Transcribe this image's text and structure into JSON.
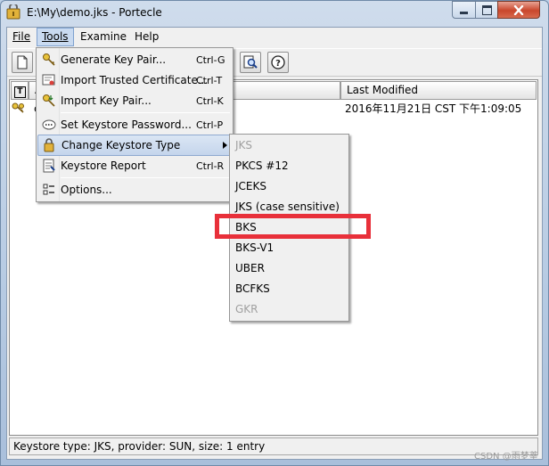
{
  "window": {
    "title": "E:\\My\\demo.jks - Portecle",
    "minimize_icon": "minimize-icon",
    "maximize_icon": "maximize-icon",
    "close_icon": "close-icon"
  },
  "menubar": {
    "items": [
      {
        "label": "File",
        "accel_char": "F"
      },
      {
        "label": "Tools",
        "accel_char": "T"
      },
      {
        "label": "Examine",
        "accel_char": "E"
      },
      {
        "label": "Help",
        "accel_char": "H"
      }
    ]
  },
  "toolbar": {
    "buttons": [
      {
        "icon": "new-keystore-icon"
      },
      {
        "icon": "examine-icon"
      },
      {
        "icon": "help-icon"
      }
    ]
  },
  "table": {
    "columns": [
      "T",
      "A",
      "Last Modified"
    ],
    "rows": [
      {
        "type_icon": "key-pair-icon",
        "alias": "c",
        "last_modified": "2016年11月21日 CST 下午1:09:05"
      }
    ]
  },
  "tools_menu": {
    "items": [
      {
        "label": "Generate Key Pair...",
        "accel": "Ctrl-G",
        "icon": "key-pair-icon"
      },
      {
        "label": "Import Trusted Certificate...",
        "accel": "Ctrl-T",
        "icon": "certificate-icon"
      },
      {
        "label": "Import Key Pair...",
        "accel": "Ctrl-K",
        "icon": "import-key-icon"
      },
      {
        "label": "Set Keystore Password...",
        "accel": "Ctrl-P",
        "icon": "password-icon"
      },
      {
        "label": "Change Keystore Type",
        "accel": "",
        "icon": "change-type-icon"
      },
      {
        "label": "Keystore Report",
        "accel": "Ctrl-R",
        "icon": "report-icon"
      },
      {
        "label": "Options...",
        "accel": "",
        "icon": "options-icon"
      }
    ]
  },
  "keystore_type_submenu": {
    "items": [
      {
        "label": "JKS",
        "enabled": false
      },
      {
        "label": "PKCS #12",
        "enabled": true
      },
      {
        "label": "JCEKS",
        "enabled": true
      },
      {
        "label": "JKS (case sensitive)",
        "enabled": true
      },
      {
        "label": "BKS",
        "enabled": true
      },
      {
        "label": "BKS-V1",
        "enabled": true
      },
      {
        "label": "UBER",
        "enabled": true
      },
      {
        "label": "BCFKS",
        "enabled": true
      },
      {
        "label": "GKR",
        "enabled": false
      }
    ]
  },
  "status_bar": {
    "text": "Keystore type: JKS, provider: SUN, size: 1 entry"
  },
  "watermark": "CSDN @雨梦莘",
  "colors": {
    "highlight_box": "#e8303a",
    "menu_highlight": "#c4d5ec"
  }
}
